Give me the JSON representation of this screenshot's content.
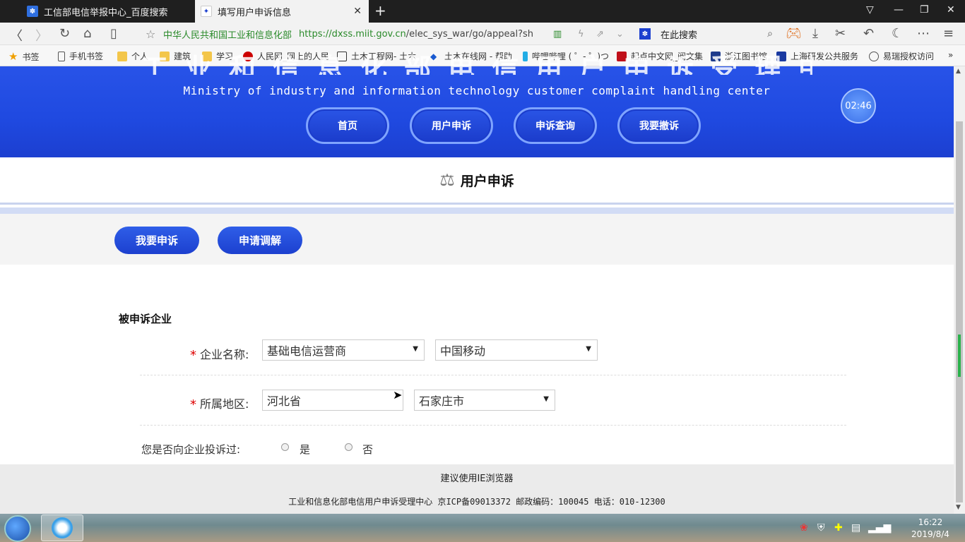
{
  "browser": {
    "tabs": [
      {
        "label": "工信部电信举报中心_百度搜索"
      },
      {
        "label": "填写用户申诉信息"
      }
    ],
    "address": {
      "site_name": "中华人民共和国工业和信息化部",
      "url_scheme_host": "https://dxss.miit.gov.cn",
      "url_path": "/elec_sys_war/go/appeal?sh"
    },
    "search_placeholder": "在此搜索",
    "bookmarks": [
      {
        "label": "书签"
      },
      {
        "label": "手机书签"
      },
      {
        "label": "个人"
      },
      {
        "label": "建筑"
      },
      {
        "label": "学习"
      },
      {
        "label": "人民网_网上的人民"
      },
      {
        "label": "土木工程网- 土木"
      },
      {
        "label": "土木在线网 - 帮助"
      },
      {
        "label": "哔哩哔哩 ( ゜- ゜)つ"
      },
      {
        "label": "起点中文网_阅文集"
      },
      {
        "label": "浙江图书馆"
      },
      {
        "label": "上海研发公共服务"
      },
      {
        "label": "易瑞授权访问"
      }
    ]
  },
  "banner": {
    "title": "工业和信息化部电信用户申诉受理中心",
    "subtitle": "Ministry of industry and information technology customer complaint handling center",
    "nav": [
      {
        "label": "首页"
      },
      {
        "label": "用户申诉"
      },
      {
        "label": "申诉查询"
      },
      {
        "label": "我要撤诉"
      }
    ],
    "timer": "02:46"
  },
  "section": {
    "title": "用户申诉"
  },
  "actions": [
    {
      "label": "我要申诉"
    },
    {
      "label": "申请调解"
    }
  ],
  "form": {
    "legend": "被申诉企业",
    "company_label": "企业名称:",
    "company_type": "基础电信运营商",
    "company_name": "中国移动",
    "region_label": "所属地区:",
    "province": "河北省",
    "city": "石家庄市",
    "complained_label": "您是否向企业投诉过:",
    "yes": "是",
    "no": "否"
  },
  "footer": {
    "browser_note": "建议使用IE浏览器",
    "info": "工业和信息化部电信用户申诉受理中心 京ICP备09013372 邮政编码：100045 电话：010-12300"
  },
  "taskbar": {
    "time": "16:22",
    "date": "2019/8/4"
  },
  "colors": {
    "banner_blue": "#1f49e0",
    "button_blue": "#1c40cf",
    "required_red": "#dd0000"
  }
}
